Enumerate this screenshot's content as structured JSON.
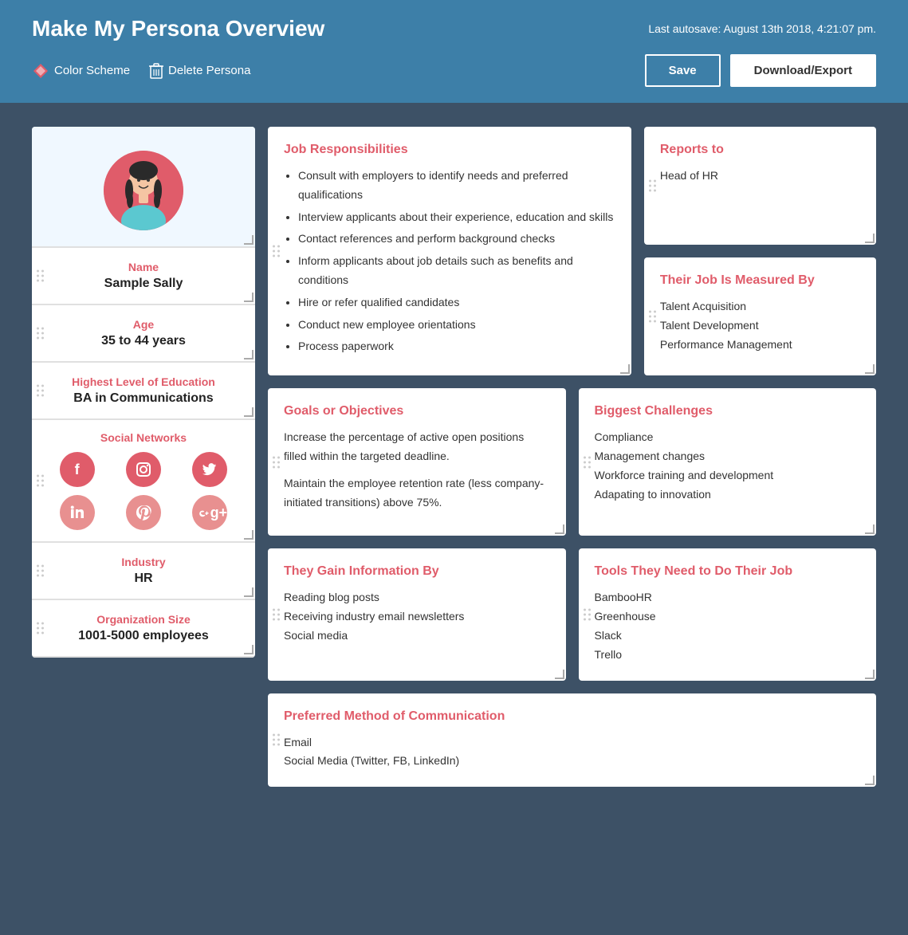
{
  "header": {
    "title": "Make My Persona Overview",
    "autosave": "Last autosave: August 13th 2018, 4:21:07 pm.",
    "color_scheme_label": "Color Scheme",
    "delete_persona_label": "Delete Persona",
    "save_label": "Save",
    "download_label": "Download/Export"
  },
  "left_panel": {
    "name_label": "Name",
    "name_value": "Sample Sally",
    "age_label": "Age",
    "age_value": "35 to 44 years",
    "education_label": "Highest Level of Education",
    "education_value": "BA in Communications",
    "social_label": "Social Networks",
    "social_icons": [
      "f",
      "inst",
      "tw",
      "in",
      "p",
      "g+"
    ],
    "industry_label": "Industry",
    "industry_value": "HR",
    "org_size_label": "Organization Size",
    "org_size_value": "1001-5000 employees"
  },
  "cards": {
    "job_responsibilities": {
      "title": "Job Responsibilities",
      "items": [
        "Consult with employers to identify needs and preferred qualifications",
        "Interview applicants about their experience, education and skills",
        "Contact references and perform background checks",
        "Inform applicants about job details such as benefits and conditions",
        "Hire or refer qualified candidates",
        "Conduct new employee orientations",
        "Process paperwork"
      ]
    },
    "reports_to": {
      "title": "Reports to",
      "value": "Head of HR"
    },
    "job_measured_by": {
      "title": "Their Job Is Measured By",
      "items": [
        "Talent Acquisition",
        "Talent Development",
        "Performance Management"
      ]
    },
    "goals": {
      "title": "Goals or Objectives",
      "paragraphs": [
        "Increase the percentage of active open positions filled within the targeted deadline.",
        "Maintain the employee retention rate (less company-initiated transitions) above 75%."
      ]
    },
    "biggest_challenges": {
      "title": "Biggest Challenges",
      "items": [
        "Compliance",
        "Management changes",
        "Workforce training and development",
        "Adapating to innovation"
      ]
    },
    "gain_information": {
      "title": "They Gain Information By",
      "items": [
        "Reading blog posts",
        "Receiving industry email newsletters",
        "Social media"
      ]
    },
    "tools": {
      "title": "Tools They Need to Do Their Job",
      "items": [
        "BambooHR",
        "Greenhouse",
        "Slack",
        "Trello"
      ]
    },
    "communication": {
      "title": "Preferred Method of Communication",
      "items": [
        "Email",
        "Social Media (Twitter, FB, LinkedIn)"
      ]
    }
  }
}
